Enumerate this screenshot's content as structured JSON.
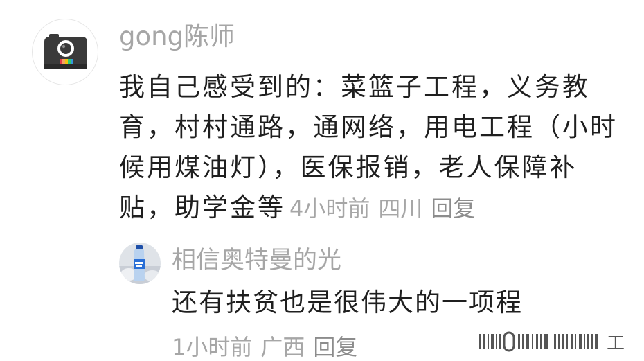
{
  "main_comment": {
    "username": "gong陈师",
    "text": "我自己感受到的：菜篮子工程，义务教育，村村通路，通网络，用电工程（小时候用煤油灯），医保报销，老人保障补贴，助学金等",
    "time": "4小时前",
    "location": "四川",
    "reply_label": "回复",
    "avatar_icon": "polaroid-camera-icon"
  },
  "reply_comment": {
    "username": "相信奥特曼的光",
    "text": "还有扶贫也是很伟大的一项程",
    "time": "1小时前",
    "location": "广西",
    "reply_label": "回复",
    "avatar_icon": "water-bottle-photo"
  },
  "watermark": {
    "text": "工"
  },
  "colors": {
    "text_primary": "#1f1f1f",
    "text_secondary": "#a6a6a6",
    "background": "#ffffff"
  }
}
